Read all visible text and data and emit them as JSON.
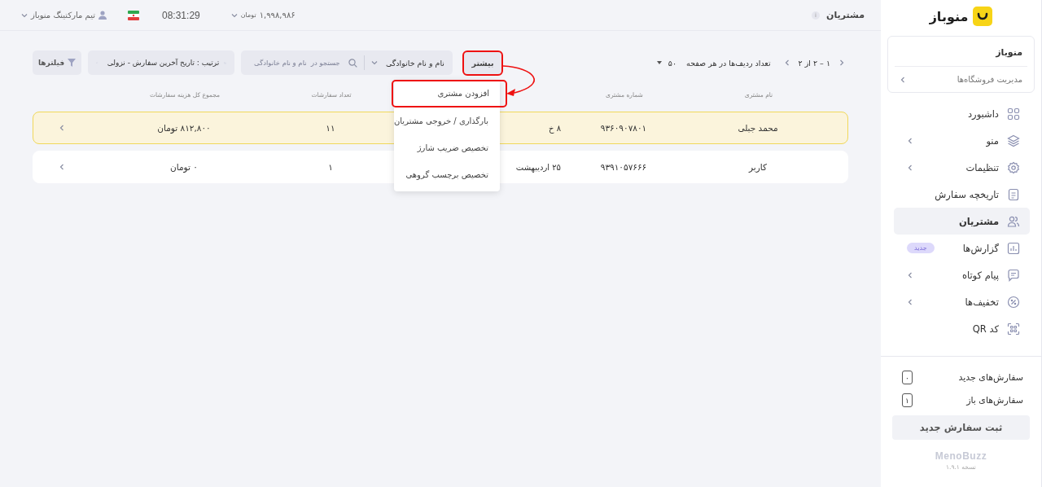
{
  "topbar": {
    "page_title": "مشتریان",
    "info": "i",
    "balance": "۱,۹۹۸,۹۸۶",
    "currency": "تومان",
    "time": "08:31:29",
    "user": "تیم مارکتینگ منوباز"
  },
  "sidebar": {
    "logo": "منوباز",
    "store": {
      "name": "منوباز",
      "manage": "مدیریت فروشگاه‌ها"
    },
    "items": [
      {
        "label": "داشبورد",
        "kind": "grid",
        "has_children": false,
        "selected": false
      },
      {
        "label": "منو",
        "kind": "layers",
        "has_children": true,
        "selected": false
      },
      {
        "label": "تنظیمات",
        "kind": "gear",
        "has_children": true,
        "selected": false
      },
      {
        "label": "تاریخچه سفارش",
        "kind": "doc",
        "has_children": false,
        "selected": false
      },
      {
        "label": "مشتریان",
        "kind": "users",
        "has_children": false,
        "selected": true
      },
      {
        "label": "گزارش‌ها",
        "kind": "chart",
        "has_children": false,
        "selected": false,
        "badge": "جدید"
      },
      {
        "label": "پیام کوتاه",
        "kind": "chat",
        "has_children": true,
        "selected": false
      },
      {
        "label": "تخفیف‌ها",
        "kind": "percent",
        "has_children": true,
        "selected": false
      },
      {
        "label": "کد QR",
        "kind": "qr",
        "has_children": false,
        "selected": false
      }
    ],
    "counters": [
      {
        "label": "سفارش‌های جدید",
        "count": "۰"
      },
      {
        "label": "سفارش‌های باز",
        "count": "۱"
      }
    ],
    "new_order_button": "ثبت سفارش جدید",
    "brand": "MenoBuzz",
    "version": "نسخه ۱.۹.۱"
  },
  "toolbar": {
    "pagination": "۱ – ۲ از ۲",
    "rows_per_page_label": "تعداد ردیف‌ها در هر صفحه",
    "rows_per_page": "۵۰",
    "more_button": {
      "label": "بیشتر",
      "highlighted": true
    },
    "search": {
      "field_select": "نام و نام خانوادگی",
      "placeholder": "جستجو در  نام و نام خانوادگی"
    },
    "sort": "ترتیب : تاریخ آخرین سفارش - نزولی",
    "filters": "فیلترها"
  },
  "more_menu": [
    {
      "label": "افزودن مشتری",
      "highlighted": true
    },
    {
      "label": "بارگذاری / خروجی مشتریان",
      "highlighted": false
    },
    {
      "label": "تخصیص ضریب شارژ",
      "highlighted": false
    },
    {
      "label": "تخصیص برچسب گروهی",
      "highlighted": false
    }
  ],
  "table": {
    "columns": [
      "نام مشتری",
      "شماره مشتری",
      "",
      "تعداد سفارشات",
      "مجموع کل هزینه سفارشات"
    ],
    "rows": [
      {
        "name": "محمد جبلی",
        "phone": "۹۳۶۰۹۰۷۸۰۱",
        "column_3": "۸ خ",
        "orders": "۱۱",
        "total": "۸۱۲,۸۰۰  تومان",
        "selected": true
      },
      {
        "name": "کاربر",
        "phone": "۹۳۹۱۰۵۷۶۶۶",
        "column_3": "۲۵ اردیبهشت",
        "orders": "۱",
        "total": "۰ تومان",
        "selected": false
      }
    ]
  }
}
